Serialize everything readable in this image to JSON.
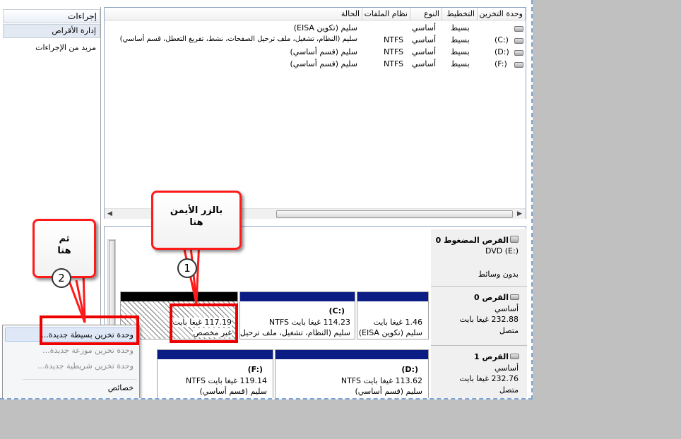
{
  "actions_pane": {
    "header": "إجراءات",
    "selected": "إدارة الأقراص",
    "more": "مزيد من الإجراءات"
  },
  "volume_list": {
    "columns": [
      "وحدة التخزين",
      "التخطيط",
      "النوع",
      "نظام الملفات",
      "الحالة"
    ],
    "rows": [
      {
        "volume": "",
        "layout": "بسيط",
        "type": "أساسي",
        "fs": "",
        "status": "سليم (تكوين EISA)"
      },
      {
        "volume": "(C:)",
        "layout": "بسيط",
        "type": "أساسي",
        "fs": "NTFS",
        "status": "سليم (النظام، تشغيل، ملف ترحيل الصفحات، نشط، تفريغ التعطل، قسم أساسي)"
      },
      {
        "volume": "(D:)",
        "layout": "بسيط",
        "type": "أساسي",
        "fs": "NTFS",
        "status": "سليم (قسم أساسي)"
      },
      {
        "volume": "(F:)",
        "layout": "بسيط",
        "type": "أساسي",
        "fs": "NTFS",
        "status": "سليم (قسم أساسي)"
      }
    ]
  },
  "disks": {
    "cdrom": {
      "name": "القرص المضغوط 0",
      "drive": "DVD (E:)",
      "media": "بدون وسائط"
    },
    "disk0": {
      "name": "القرص 0",
      "type": "أساسي",
      "size": "232.88 غيغا بايت",
      "state": "متصل",
      "partitions": [
        {
          "size": "1.46 غيغا بايت",
          "desc": "سليم (تكوين EISA)"
        },
        {
          "label": "(C:)",
          "size": "114.23 غيغا بايت NTFS",
          "desc": "سليم (النظام، تشغيل، ملف ترحيل"
        },
        {
          "size": "117.19 غيغا بايت",
          "desc": "غير مخصص"
        }
      ]
    },
    "disk1": {
      "name": "القرص 1",
      "type": "أساسي",
      "size": "232.76 غيغا بايت",
      "state": "متصل",
      "partitions": [
        {
          "label": "(D:)",
          "size": "113.62 غيغا بايت NTFS",
          "desc": "سليم (قسم أساسي)"
        },
        {
          "label": "(F:)",
          "size": "119.14 غيغا بايت NTFS",
          "desc": "سليم (قسم أساسي)"
        }
      ]
    }
  },
  "context_menu": {
    "items": [
      {
        "label": "وحدة تخزين بسيطة جديدة...",
        "enabled": true
      },
      {
        "label": "وحدة تخزين موزعة جديدة...",
        "enabled": false
      },
      {
        "label": "وحدة تخزين شريطية جديدة...",
        "enabled": false
      },
      {
        "label": "خصائص",
        "enabled": true
      }
    ]
  },
  "annotations": {
    "callout1": {
      "line1": "بالزر الأيمن",
      "line2": "هنا",
      "number": "1"
    },
    "callout2": {
      "line1": "ثم",
      "line2": "هنا",
      "number": "2"
    },
    "highlight_color": "#ee0000"
  }
}
